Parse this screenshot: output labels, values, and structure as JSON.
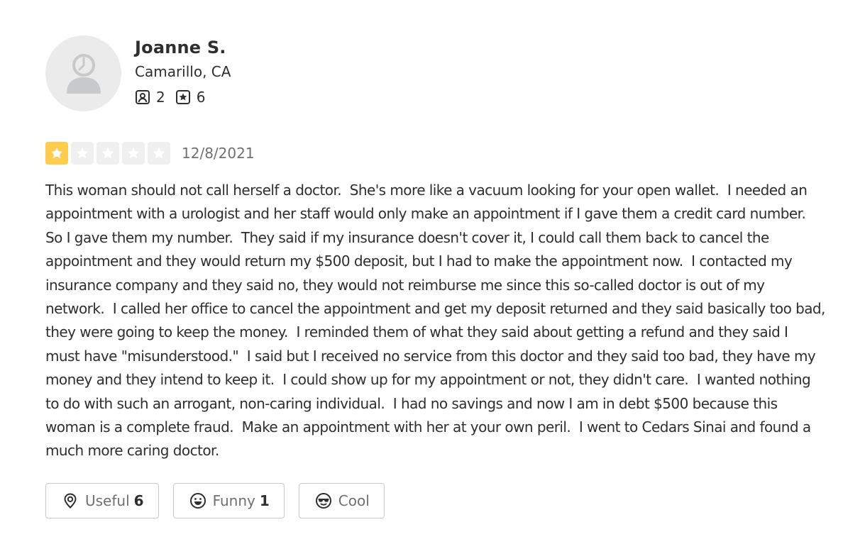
{
  "user": {
    "name": "Joanne S.",
    "location": "Camarillo, CA",
    "review_count": "2",
    "photo_count": "6"
  },
  "rating": {
    "value": 1,
    "max": 5,
    "filled_color": "#ffcc4b",
    "empty_color": "#f0f0f0"
  },
  "review": {
    "date": "12/8/2021",
    "text": "This woman should not call herself a doctor.  She's more like a vacuum looking for your open wallet.  I needed an appointment with a urologist and her staff would only make an appointment if I gave them a credit card number.  So I gave them my number.  They said if my insurance doesn't cover it, I could call them back to cancel the appointment and they would return my $500 deposit, but I had to make the appointment now.  I contacted my insurance company and they said no, they would not reimburse me since this so-called doctor is out of my network.  I called her office to cancel the appointment and get my deposit returned and they said basically too bad, they were going to keep the money.  I reminded them of what they said about getting a refund and they said I must have \"misunderstood.\"  I said but I received no service from this doctor and they said too bad, they have my money and they intend to keep it.  I could show up for my appointment or not, they didn't care.  I wanted nothing to do with such an arrogant, non-caring individual.  I had no savings and now I am in debt $500 because this woman is a complete fraud.  Make an appointment with her at your own peril.  I went to Cedars Sinai and found a much more caring doctor."
  },
  "reactions": {
    "useful": {
      "label": "Useful",
      "count": "6",
      "icon": "lightbulb-icon"
    },
    "funny": {
      "label": "Funny",
      "count": "1",
      "icon": "smile-icon"
    },
    "cool": {
      "label": "Cool",
      "count": "",
      "icon": "sunglasses-icon"
    }
  }
}
